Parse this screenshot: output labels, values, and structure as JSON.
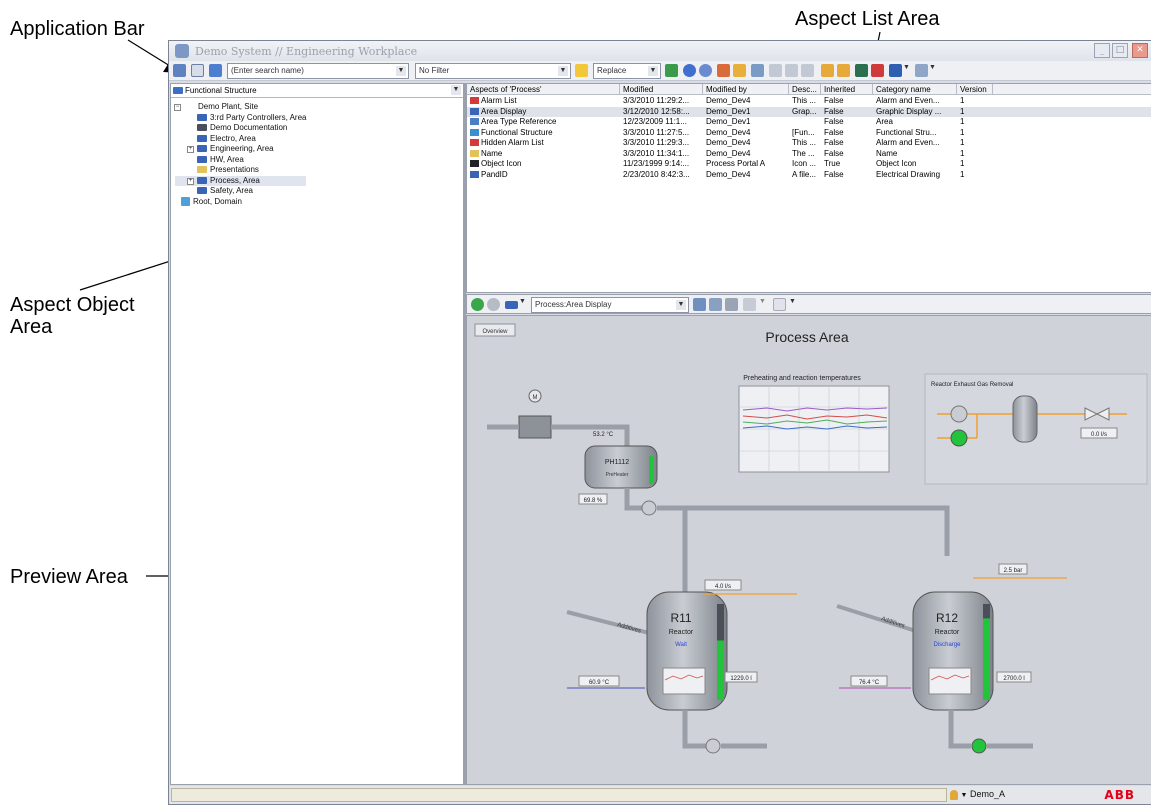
{
  "callouts": {
    "application_bar": "Application Bar",
    "aspect_list_area": "Aspect List Area",
    "aspect_object_area": "Aspect Object\nArea",
    "preview_area": "Preview Area"
  },
  "window": {
    "title": "Demo System // Engineering Workplace"
  },
  "toolbar": {
    "search_placeholder": "(Enter search name)",
    "filter": "No Filter",
    "replace": "Replace"
  },
  "structure": {
    "selected": "Functional Structure"
  },
  "tree": [
    {
      "label": "Demo Plant, Site",
      "icon": "site-icon"
    },
    {
      "label": "3:rd Party Controllers, Area",
      "icon": "area-icon"
    },
    {
      "label": "Demo Documentation",
      "icon": "documentation-icon"
    },
    {
      "label": "Electro, Area",
      "icon": "area-icon"
    },
    {
      "label": "Engineering, Area",
      "icon": "area-icon"
    },
    {
      "label": "HW, Area",
      "icon": "area-icon"
    },
    {
      "label": "Presentations",
      "icon": "folder-icon"
    },
    {
      "label": "Process, Area",
      "icon": "area-icon"
    },
    {
      "label": "Safety, Area",
      "icon": "area-icon"
    },
    {
      "label": "Root, Domain",
      "icon": "domain-icon"
    }
  ],
  "aspect_list": {
    "columns": [
      "Aspects of 'Process'",
      "Modified",
      "Modified by",
      "Desc...",
      "Inherited",
      "Category name",
      "Version"
    ],
    "rows": [
      [
        "Alarm List",
        "3/3/2010 11:29:2...",
        "Demo_Dev4",
        "This ...",
        "False",
        "Alarm and Even...",
        "1"
      ],
      [
        "Area Display",
        "3/12/2010 12:58:...",
        "Demo_Dev1",
        "Grap...",
        "False",
        "Graphic Display ...",
        "1"
      ],
      [
        "Area Type Reference",
        "12/23/2009 11:1...",
        "Demo_Dev1",
        "",
        "False",
        "Area",
        "1"
      ],
      [
        "Functional Structure",
        "3/3/2010 11:27:5...",
        "Demo_Dev4",
        "[Fun...",
        "False",
        "Functional Stru...",
        "1"
      ],
      [
        "Hidden Alarm List",
        "3/3/2010 11:29:3...",
        "Demo_Dev4",
        "This ...",
        "False",
        "Alarm and Even...",
        "1"
      ],
      [
        "Name",
        "3/3/2010 11:34:1...",
        "Demo_Dev4",
        "The ...",
        "False",
        "Name",
        "1"
      ],
      [
        "Object Icon",
        "11/23/1999 9:14:...",
        "Process Portal A",
        "Icon ...",
        "True",
        "Object Icon",
        "1"
      ],
      [
        "PandID",
        "2/23/2010 8:42:3...",
        "Demo_Dev4",
        "A file...",
        "False",
        "Electrical Drawing",
        "1"
      ]
    ],
    "selected_index": 1
  },
  "preview_toolbar": {
    "path": "Process:Area Display"
  },
  "process": {
    "overview": "Overview",
    "title": "Process Area",
    "trend_title": "Preheating and reaction temperatures",
    "exhaust_title": "Reactor Exhaust Gas Removal",
    "exhaust_flow": "0.0 l/s",
    "preheater_id": "PH1112",
    "preheater_label": "PreHeater",
    "preheater_temp": "53.2 °C",
    "preheater_level": "69.8 %",
    "additives": "Additives",
    "r11": {
      "id": "R11",
      "label": "Reactor",
      "state": "Wait",
      "flow": "4.0 l/s",
      "temp": "60.9 °C",
      "level": "1229.0 l",
      "fill": 0.62
    },
    "r12": {
      "id": "R12",
      "label": "Reactor",
      "state": "Discharge",
      "pressure": "2.5 bar",
      "temp": "76.4 °C",
      "level": "2700.0 l",
      "fill": 0.85
    }
  },
  "status": {
    "user": "Demo_A",
    "brand": "ABB"
  },
  "colors": {
    "accent_green": "#21c43a",
    "alarm_red": "#d43a3a",
    "line_orange": "#f0a030",
    "pipe_grey": "#9a9ea6"
  }
}
